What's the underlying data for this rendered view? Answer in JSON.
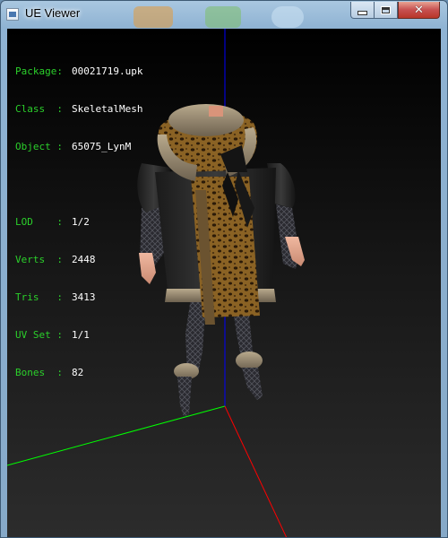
{
  "window": {
    "title": "UE Viewer",
    "minimize_icon": "minimize-icon",
    "maximize_icon": "maximize-icon",
    "close_icon": "close-icon",
    "close_glyph": "✕"
  },
  "info_panel": {
    "object_rows": [
      {
        "label": "Package:",
        "value": "00021719.upk"
      },
      {
        "label": "Class  :",
        "value": "SkeletalMesh"
      },
      {
        "label": "Object :",
        "value": "65075_LynM"
      }
    ],
    "mesh_rows": [
      {
        "label": "LOD    :",
        "value": "1/2"
      },
      {
        "label": "Verts  :",
        "value": "2448"
      },
      {
        "label": "Tris   :",
        "value": "3413"
      },
      {
        "label": "UV Set :",
        "value": "1/1"
      },
      {
        "label": "Bones  :",
        "value": "82"
      }
    ],
    "label_color": "#2bd02b",
    "value_color": "#ffffff"
  },
  "viewport": {
    "axis_colors": {
      "x": "#ff0000",
      "y": "#00ff00",
      "z": "#0000ff"
    }
  }
}
